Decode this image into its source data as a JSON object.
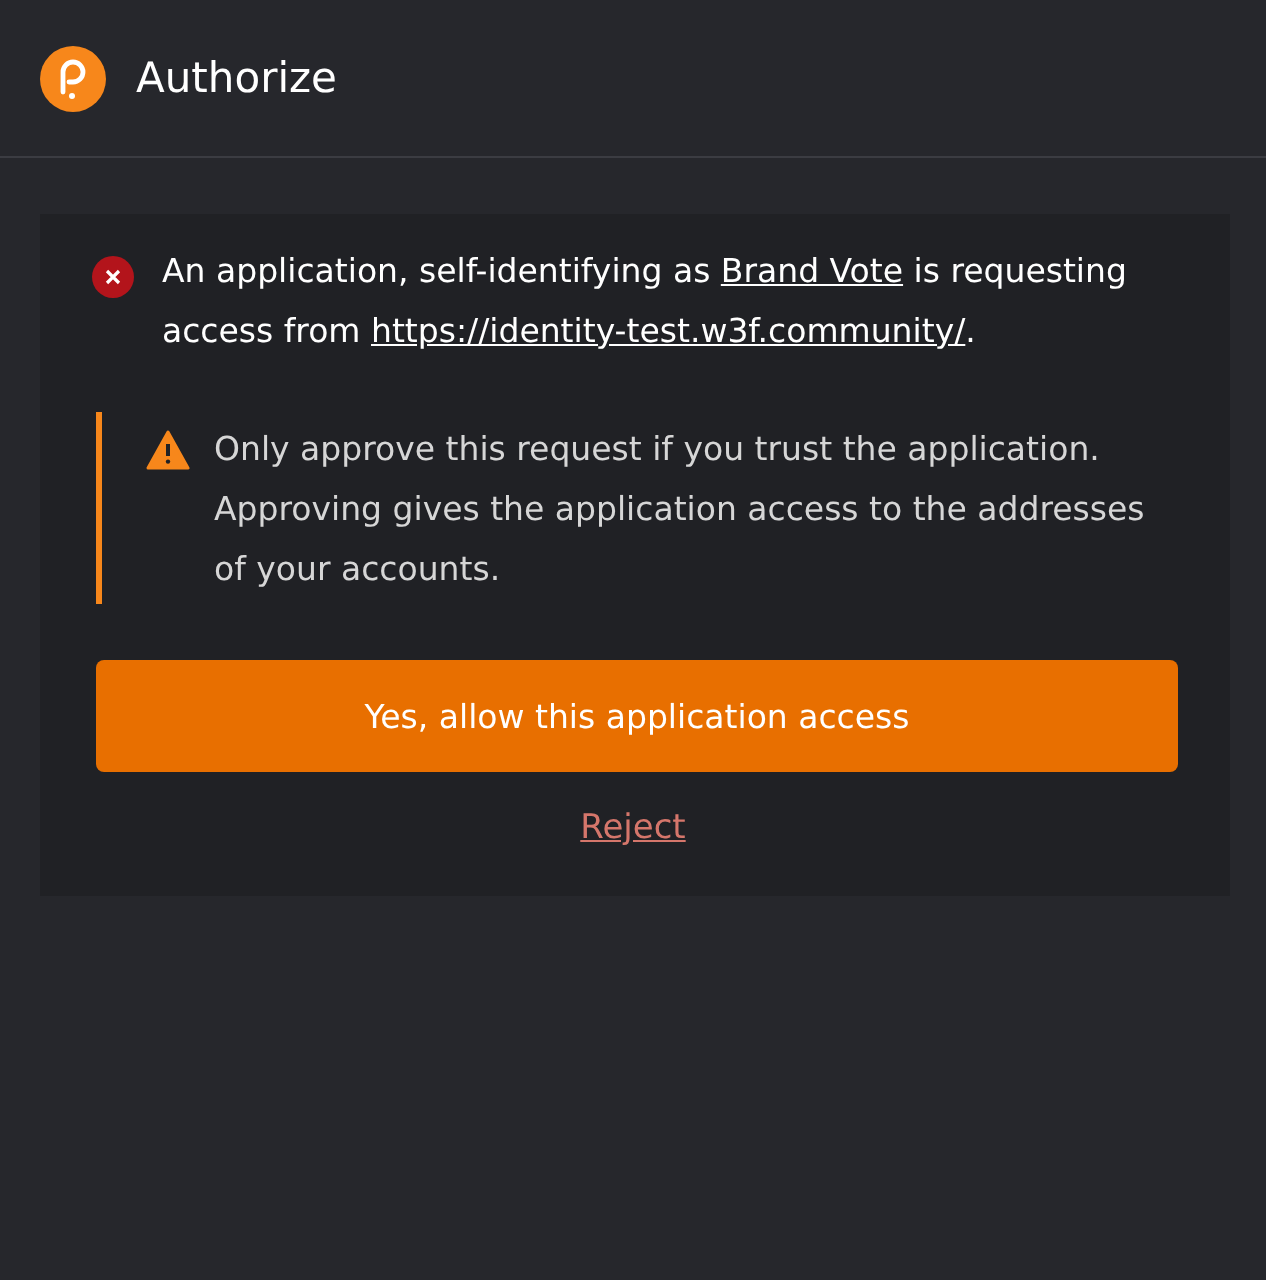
{
  "header": {
    "title": "Authorize"
  },
  "request": {
    "parts": [
      {
        "kind": "text",
        "text": "An application, self-identifying as "
      },
      {
        "kind": "link",
        "text": "Brand Vote"
      },
      {
        "kind": "text",
        "text": " is requesting access from "
      },
      {
        "kind": "link",
        "text": "https://identity-test.w3f.community/"
      },
      {
        "kind": "text",
        "text": "."
      }
    ]
  },
  "warning": {
    "text": "Only approve this request if you trust the application. Approving gives the application access to the addresses of your accounts."
  },
  "buttons": [
    {
      "kind": "primary",
      "label": "Yes, allow this application access"
    },
    {
      "kind": "link",
      "label": "Reject"
    }
  ]
}
